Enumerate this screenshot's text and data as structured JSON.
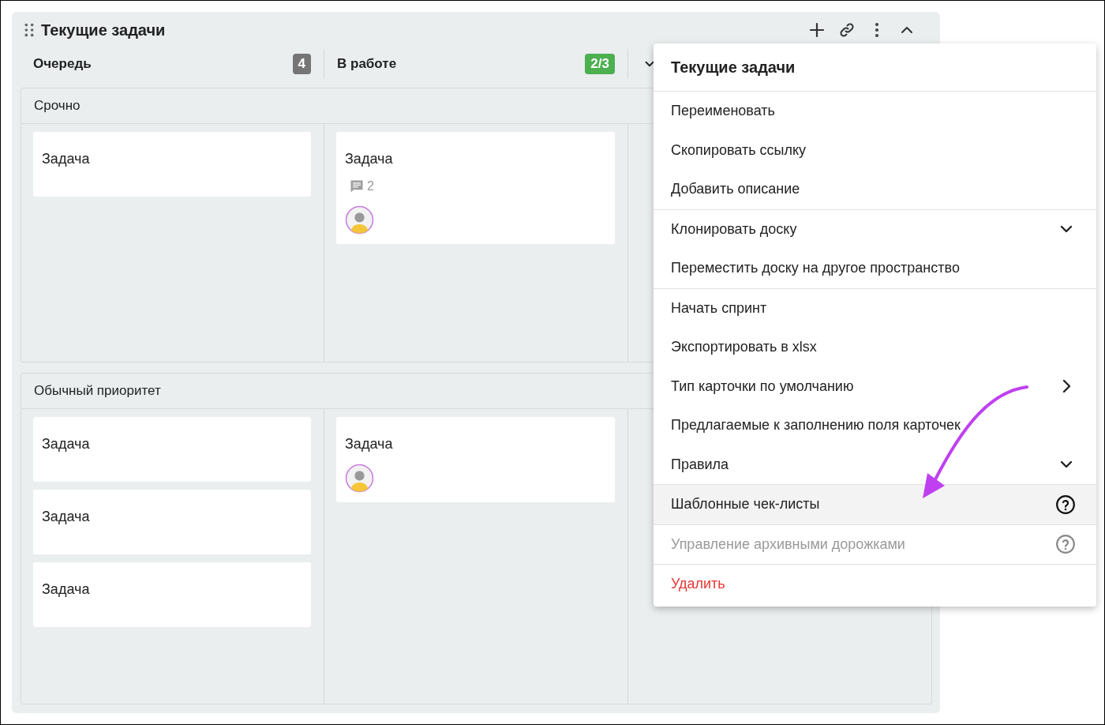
{
  "board": {
    "title": "Текущие задачи",
    "columns": [
      {
        "kind": "column",
        "label": "Очередь",
        "count": "4",
        "color": "#757575"
      },
      {
        "kind": "column",
        "label": "В работе",
        "count": "2/3",
        "color": "#4caf50"
      },
      {
        "kind": "partial"
      }
    ],
    "lanes": [
      {
        "title": "Срочно",
        "cells": [
          [
            {
              "title": "Задача",
              "avatar": false
            }
          ],
          [
            {
              "title": "Задача",
              "comments": "2",
              "avatar": true
            }
          ],
          []
        ]
      },
      {
        "title": "Обычный приоритет",
        "cells": [
          [
            {
              "title": "Задача",
              "avatar": false
            },
            {
              "title": "Задача",
              "avatar": false
            },
            {
              "title": "Задача",
              "avatar": false
            }
          ],
          [
            {
              "title": "Задача",
              "avatar": true
            }
          ],
          []
        ]
      }
    ]
  },
  "menu": {
    "title": "Текущие задачи",
    "sections": [
      [
        {
          "label": "Переименовать",
          "kind": "action",
          "highlighted": false,
          "disabled": false
        },
        {
          "label": "Скопировать ссылку",
          "kind": "action",
          "highlighted": false,
          "disabled": false
        },
        {
          "label": "Добавить описание",
          "kind": "action",
          "highlighted": false,
          "disabled": false
        }
      ],
      [
        {
          "label": "Клонировать доску",
          "kind": "expand",
          "highlighted": false,
          "disabled": false
        },
        {
          "label": "Переместить доску на другое пространство",
          "kind": "action",
          "highlighted": false,
          "disabled": false
        }
      ],
      [
        {
          "label": "Начать спринт",
          "kind": "action",
          "highlighted": false,
          "disabled": false
        },
        {
          "label": "Экспортировать в xlsx",
          "kind": "action",
          "highlighted": false,
          "disabled": false
        },
        {
          "label": "Тип карточки по умолчанию",
          "kind": "submenu",
          "highlighted": false,
          "disabled": false
        },
        {
          "label": "Предлагаемые к заполнению поля карточек",
          "kind": "action",
          "highlighted": false,
          "disabled": false
        },
        {
          "label": "Правила",
          "kind": "expand",
          "highlighted": false,
          "disabled": false
        }
      ],
      [
        {
          "label": "Шаблонные чек-листы",
          "kind": "help",
          "highlighted": true,
          "disabled": false
        }
      ],
      [
        {
          "label": "Управление архивными дорожками",
          "kind": "help",
          "highlighted": false,
          "disabled": true
        }
      ],
      [
        {
          "label": "Удалить",
          "kind": "danger",
          "highlighted": false,
          "disabled": false
        }
      ]
    ]
  }
}
